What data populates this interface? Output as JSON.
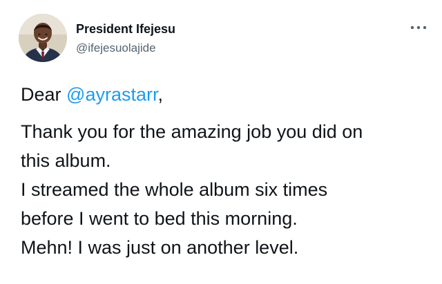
{
  "author": {
    "name": "President Ifejesu",
    "handle": "@ifejesuolajide"
  },
  "header": {
    "more_icon": "more-horizontal-icon"
  },
  "tweet": {
    "greeting_prefix": "Dear ",
    "mention": "@ayrastarr",
    "greeting_suffix": ",",
    "lines": [
      "Thank you for the amazing job you did on",
      "this album.",
      "I streamed the whole album six times",
      "before I went to bed this morning.",
      "Mehn! I was just on another level."
    ]
  },
  "colors": {
    "text": "#0f1419",
    "secondary": "#536471",
    "link": "#1d9bf0"
  }
}
